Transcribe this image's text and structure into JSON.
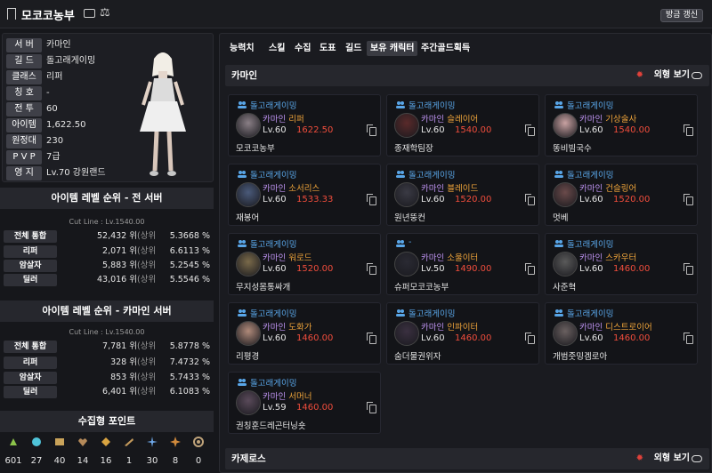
{
  "topbar": {
    "title": "모코코농부",
    "refresh_label": "방금 갱신"
  },
  "profile": {
    "rows": [
      {
        "label": "서 버",
        "value": "카마인"
      },
      {
        "label": "길 드",
        "value": "돌고래게이밍"
      },
      {
        "label": "클래스",
        "value": "리퍼"
      },
      {
        "label": "칭 호",
        "value": "-"
      },
      {
        "label": "전 투",
        "value": "60"
      },
      {
        "label": "아이템",
        "value": "1,622.50"
      },
      {
        "label": "원정대",
        "value": "230"
      },
      {
        "label": "P V P",
        "value": "7급"
      },
      {
        "label": "영 지",
        "value": "Lv.70 강원랜드"
      }
    ]
  },
  "ranking_all": {
    "title": "아이템 레벨 순위 - 전 서버",
    "cutline": "Cut Line : Lv.1540.00",
    "rows": [
      {
        "label": "전체 통합",
        "rank": "52,432 위",
        "pct": "5.3668 %"
      },
      {
        "label": "리퍼",
        "rank": "2,071 위",
        "pct": "6.6113 %"
      },
      {
        "label": "암살자",
        "rank": "5,883 위",
        "pct": "5.2545 %"
      },
      {
        "label": "딜러",
        "rank": "43,016 위",
        "pct": "5.5546 %"
      }
    ]
  },
  "ranking_server": {
    "title": "아이템 레벨 순위 - 카마인 서버",
    "cutline": "Cut Line : Lv.1540.00",
    "rows": [
      {
        "label": "전체 통합",
        "rank": "7,781 위",
        "pct": "5.8778 %"
      },
      {
        "label": "리퍼",
        "rank": "328 위",
        "pct": "7.4732 %"
      },
      {
        "label": "암살자",
        "rank": "853 위",
        "pct": "5.7433 %"
      },
      {
        "label": "딜러",
        "rank": "6,401 위",
        "pct": "6.1083 %"
      }
    ]
  },
  "pct_prefix": "(상위",
  "pct_suffix": ")",
  "collection": {
    "title": "수집형 포인트",
    "items": [
      {
        "icon": "mokoko-seed-icon",
        "value": "601",
        "color": "#8bc34a"
      },
      {
        "icon": "island-heart-icon",
        "value": "27",
        "color": "#4fc3d9"
      },
      {
        "icon": "great-art-icon",
        "value": "40",
        "color": "#c9a35a"
      },
      {
        "icon": "giant-heart-icon",
        "value": "14",
        "color": "#b58a5a"
      },
      {
        "icon": "ignea-token-icon",
        "value": "16",
        "color": "#d9a441"
      },
      {
        "icon": "adventure-tome-icon",
        "value": "1",
        "color": "#c49a5c"
      },
      {
        "icon": "world-tree-leaf-icon",
        "value": "30",
        "color": "#6fa8e8"
      },
      {
        "icon": "orpheus-star-icon",
        "value": "8",
        "color": "#d08a3c"
      },
      {
        "icon": "omnium-star-icon",
        "value": "0",
        "color": "#bfa37a"
      }
    ]
  },
  "tabs": [
    "능력치",
    "스킬",
    "수집",
    "도표",
    "길드",
    "보유 캐릭터",
    "주간골드획득"
  ],
  "active_tab": "보유 캐릭터",
  "server_sections": [
    {
      "name": "카마인",
      "look_label": "외형 보기"
    },
    {
      "name": "카제로스",
      "look_label": "외형 보기"
    }
  ],
  "characters": [
    {
      "guild": "돌고래게이밍",
      "server": "카마인",
      "class": "리퍼",
      "level": "Lv.60",
      "ilvl": "1622.50",
      "nick": "모코코농부",
      "avatar": "#8a7f86"
    },
    {
      "guild": "돌고래게이밍",
      "server": "카마인",
      "class": "슬레이어",
      "level": "Lv.60",
      "ilvl": "1540.00",
      "nick": "종재학팀장",
      "avatar": "#5a2a2a"
    },
    {
      "guild": "돌고래게이밍",
      "server": "카마인",
      "class": "기상술사",
      "level": "Lv.60",
      "ilvl": "1540.00",
      "nick": "똥비빔국수",
      "avatar": "#c9a2a2"
    },
    {
      "guild": "돌고래게이밍",
      "server": "카마인",
      "class": "소서리스",
      "level": "Lv.60",
      "ilvl": "1533.33",
      "nick": "재봉어",
      "avatar": "#4a5a7a"
    },
    {
      "guild": "돌고래게이밍",
      "server": "카마인",
      "class": "블레이드",
      "level": "Lv.60",
      "ilvl": "1520.00",
      "nick": "원년뚱컨",
      "avatar": "#3a3a44"
    },
    {
      "guild": "돌고래게이밍",
      "server": "카마인",
      "class": "건슬링어",
      "level": "Lv.60",
      "ilvl": "1520.00",
      "nick": "멋베",
      "avatar": "#6a4a4a"
    },
    {
      "guild": "돌고래게이밍",
      "server": "카마인",
      "class": "워로드",
      "level": "Lv.60",
      "ilvl": "1520.00",
      "nick": "무지성몸통싸개",
      "avatar": "#7a6a4a"
    },
    {
      "guild": "-",
      "server": "카마인",
      "class": "소울이터",
      "level": "Lv.50",
      "ilvl": "1490.00",
      "nick": "슈퍼모코코농부",
      "avatar": "#2a2a33"
    },
    {
      "guild": "돌고래게이밍",
      "server": "카마인",
      "class": "스카우터",
      "level": "Lv.60",
      "ilvl": "1460.00",
      "nick": "사준혁",
      "avatar": "#5a5a5a"
    },
    {
      "guild": "돌고래게이밍",
      "server": "카마인",
      "class": "도화가",
      "level": "Lv.60",
      "ilvl": "1460.00",
      "nick": "리평경",
      "avatar": "#b08a7a"
    },
    {
      "guild": "돌고래게이밍",
      "server": "카마인",
      "class": "인파이터",
      "level": "Lv.60",
      "ilvl": "1460.00",
      "nick": "숨더물권위자",
      "avatar": "#3a3040"
    },
    {
      "guild": "돌고래게이밍",
      "server": "카마인",
      "class": "디스트로이어",
      "level": "Lv.60",
      "ilvl": "1460.00",
      "nick": "개범줏밍겜로아",
      "avatar": "#6a6060"
    },
    {
      "guild": "돌고래게이밍",
      "server": "카마인",
      "class": "서머너",
      "level": "Lv.59",
      "ilvl": "1460.00",
      "nick": "권칭훈드레곤터닝숏",
      "avatar": "#5a4a5a"
    }
  ]
}
